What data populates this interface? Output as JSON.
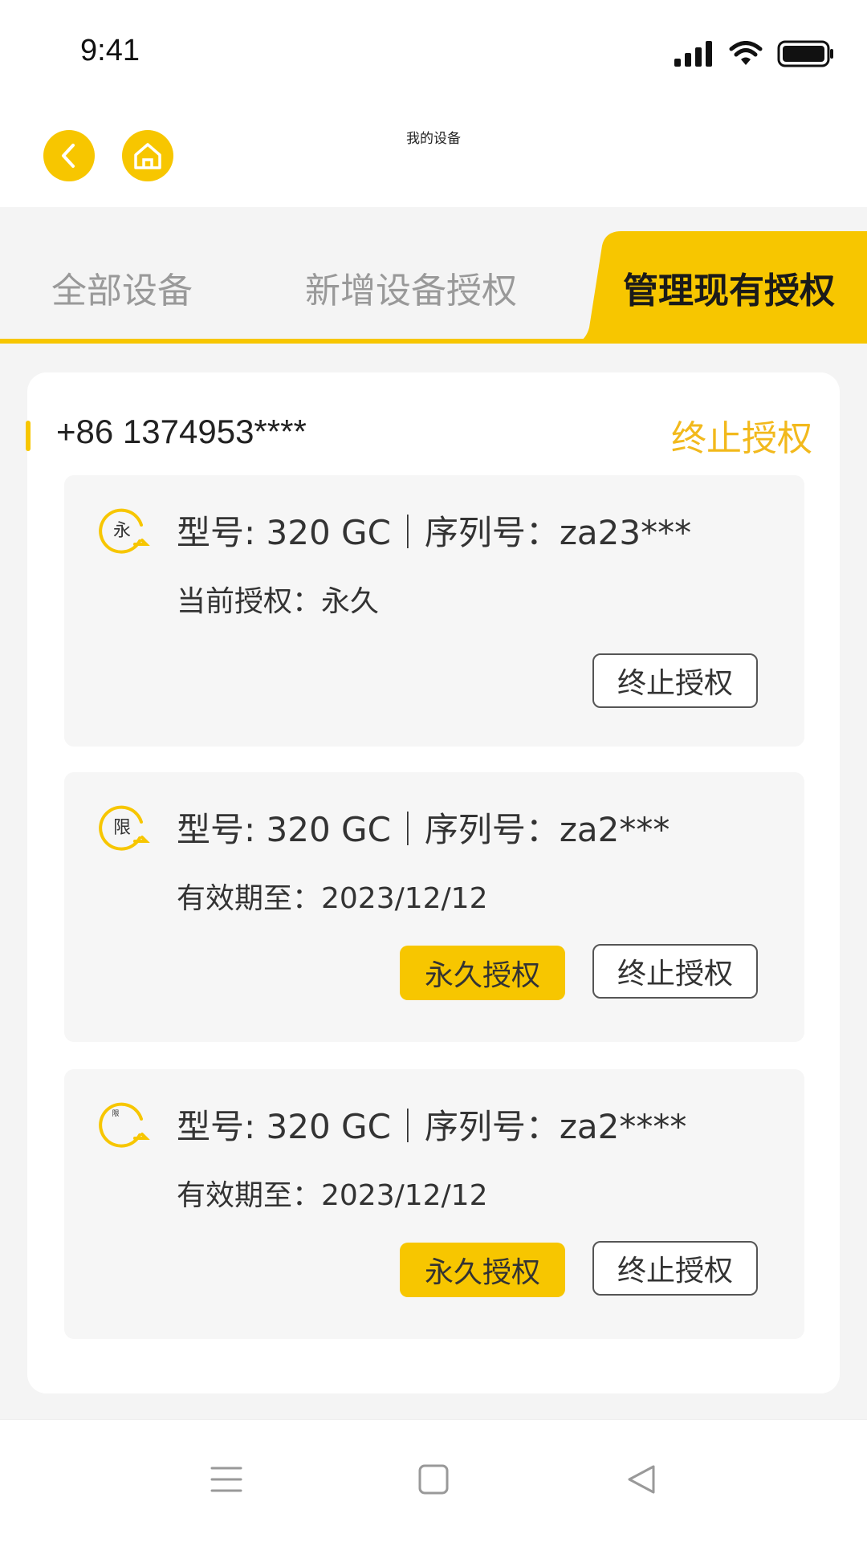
{
  "status_bar": {
    "time": "9:41",
    "icons": [
      "cellular-signal-icon",
      "wifi-icon",
      "battery-icon"
    ]
  },
  "header": {
    "title": "我的设备",
    "back_icon": "chevron-left-icon",
    "home_icon": "home-icon"
  },
  "tabs": [
    {
      "label": "全部设备",
      "active": false
    },
    {
      "label": "新增设备授权",
      "active": false
    },
    {
      "label": "管理现有授权",
      "active": true
    }
  ],
  "account": {
    "phone": "+86 1374953****",
    "terminate_label": "终止授权"
  },
  "devices": [
    {
      "badge": "永",
      "title": "型号: 320 GC｜序列号：za23***",
      "subtitle": "当前授权：永久",
      "permanent_button": "",
      "terminate_button": "终止授权"
    },
    {
      "badge": "限",
      "title": "型号: 320 GC｜序列号：za2***",
      "subtitle": "有效期至：2023/12/12",
      "permanent_button": "永久授权",
      "terminate_button": "终止授权"
    },
    {
      "badge": "限",
      "title": "型号: 320 GC｜序列号：za2****",
      "subtitle": "有效期至：2023/12/12",
      "permanent_button": "永久授权",
      "terminate_button": "终止授权"
    }
  ],
  "bottom_nav": {
    "icons": [
      "menu-icon",
      "square-home-icon",
      "triangle-back-icon"
    ]
  },
  "colors": {
    "accent": "#F7C600",
    "accent_text": "#F2B91C",
    "background": "#F4F4F4"
  }
}
